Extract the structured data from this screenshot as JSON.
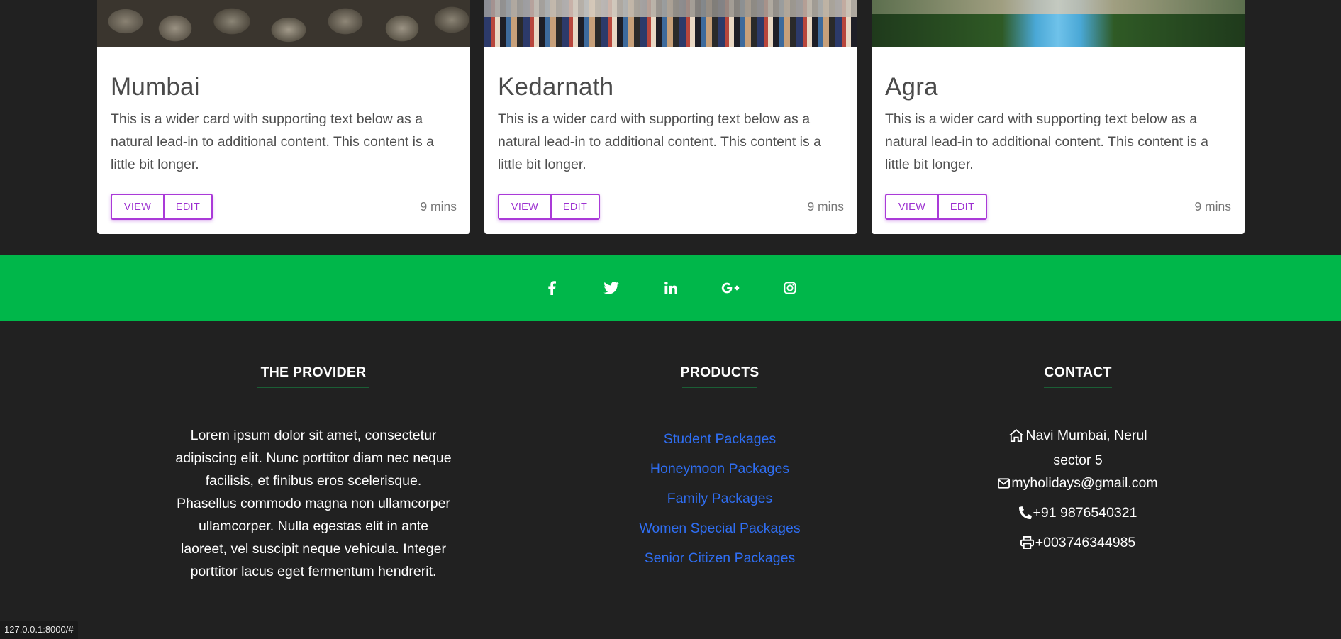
{
  "cards": [
    {
      "title": "Mumbai",
      "text": "This is a wider card with supporting text below as a natural lead-in to additional content. This content is a little bit longer.",
      "view": "VIEW",
      "edit": "EDIT",
      "time": "9 mins"
    },
    {
      "title": "Kedarnath",
      "text": "This is a wider card with supporting text below as a natural lead-in to additional content. This content is a little bit longer.",
      "view": "VIEW",
      "edit": "EDIT",
      "time": "9 mins"
    },
    {
      "title": "Agra",
      "text": "This is a wider card with supporting text below as a natural lead-in to additional content. This content is a little bit longer.",
      "view": "VIEW",
      "edit": "EDIT",
      "time": "9 mins"
    }
  ],
  "social": {
    "icons": [
      "facebook-icon",
      "twitter-icon",
      "linkedin-icon",
      "google-plus-icon",
      "instagram-icon"
    ],
    "bar_color": "#00b74a"
  },
  "footer": {
    "provider": {
      "title": "THE PROVIDER",
      "text": "Lorem ipsum dolor sit amet, consectetur adipiscing elit. Nunc porttitor diam nec neque facilisis, et finibus eros scelerisque. Phasellus commodo magna non ullamcorper ullamcorper. Nulla egestas elit in ante laoreet, vel suscipit neque vehicula. Integer porttitor lacus eget fermentum hendrerit."
    },
    "products": {
      "title": "PRODUCTS",
      "links": [
        "Student Packages",
        "Honeymoon Packages",
        "Family Packages",
        "Women Special Packages",
        "Senior Citizen Packages"
      ]
    },
    "contact": {
      "title": "CONTACT",
      "address_line1": "Navi Mumbai, Nerul",
      "address_line2": "sector 5",
      "email": "myholidays@gmail.com",
      "phone": "+91 9876540321",
      "fax": "+003746344985"
    }
  },
  "status_url": "127.0.0.1:8000/#",
  "colors": {
    "accent": "#9c2fd0",
    "link": "#2f6ef2",
    "footer_bg": "#212121"
  }
}
